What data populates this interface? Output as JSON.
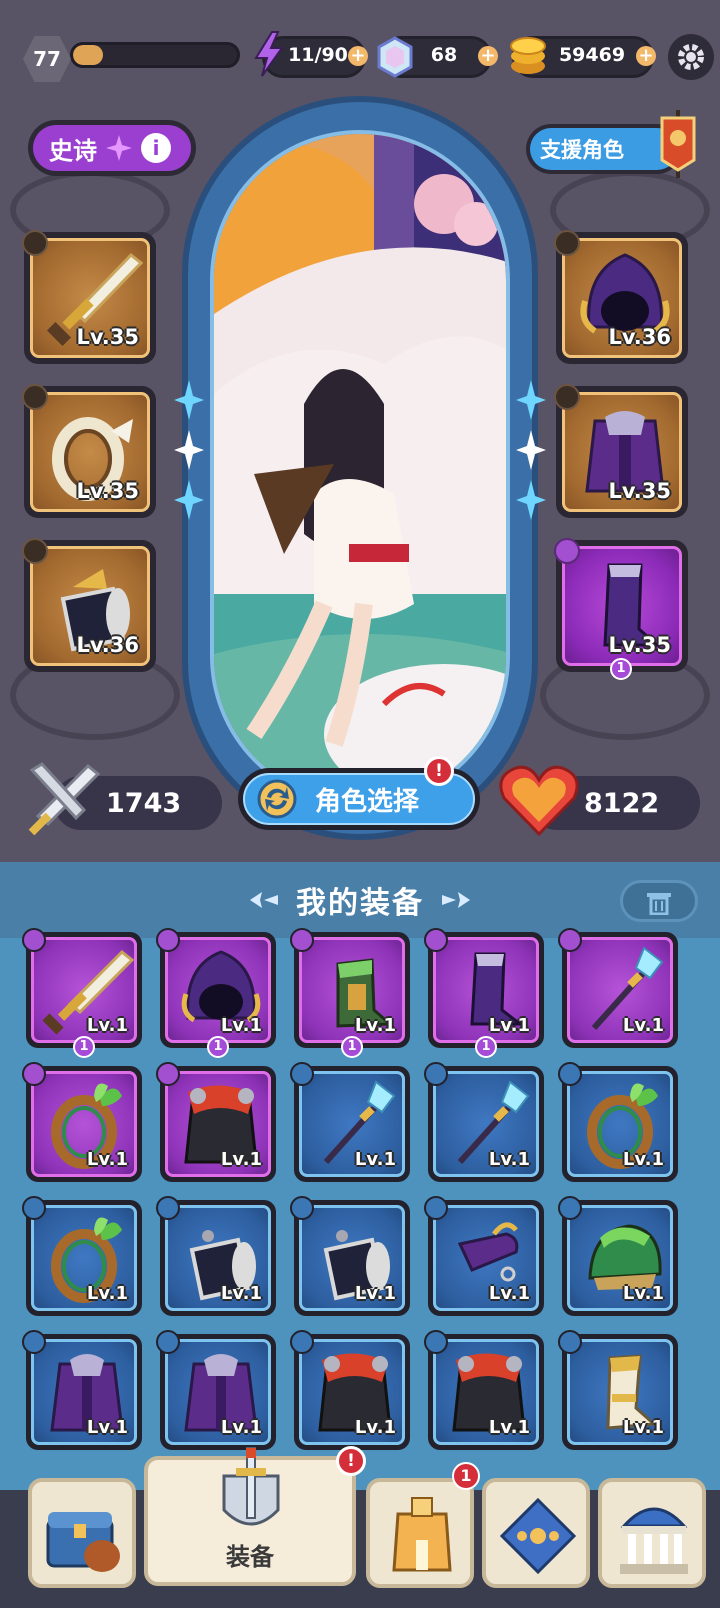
{
  "topbar": {
    "level": "77",
    "xp_progress": 0.18,
    "energy": "11/90",
    "gems": "68",
    "gold": "59469"
  },
  "hero": {
    "rarity": "史诗",
    "support_label": "支援角色",
    "power": "1743",
    "hp": "8122",
    "select_label": "角色选择",
    "select_alert": "!"
  },
  "equipped_left": [
    {
      "item": "sword",
      "level": "Lv.35"
    },
    {
      "item": "ring",
      "level": "Lv.35"
    },
    {
      "item": "bracer",
      "level": "Lv.36"
    }
  ],
  "equipped_right": [
    {
      "item": "hood",
      "level": "Lv.36",
      "rarity": "gold"
    },
    {
      "item": "armor",
      "level": "Lv.35",
      "rarity": "gold"
    },
    {
      "item": "boots",
      "level": "Lv.35",
      "rarity": "purple",
      "badge": "1"
    }
  ],
  "panel": {
    "title": "我的装备"
  },
  "inventory": [
    {
      "item": "sword",
      "level": "Lv.1",
      "rarity": "purple",
      "badge": "1"
    },
    {
      "item": "hood",
      "level": "Lv.1",
      "rarity": "purple",
      "badge": "1"
    },
    {
      "item": "boots-green",
      "level": "Lv.1",
      "rarity": "purple",
      "badge": "1"
    },
    {
      "item": "boots",
      "level": "Lv.1",
      "rarity": "purple",
      "badge": "1"
    },
    {
      "item": "spear",
      "level": "Lv.1",
      "rarity": "purple"
    },
    {
      "item": "ring-leaf",
      "level": "Lv.1",
      "rarity": "purple"
    },
    {
      "item": "armor-red",
      "level": "Lv.1",
      "rarity": "purple"
    },
    {
      "item": "spear",
      "level": "Lv.1",
      "rarity": "blue"
    },
    {
      "item": "spear",
      "level": "Lv.1",
      "rarity": "blue"
    },
    {
      "item": "ring-leaf",
      "level": "Lv.1",
      "rarity": "blue"
    },
    {
      "item": "ring-leaf",
      "level": "Lv.1",
      "rarity": "blue"
    },
    {
      "item": "bracer",
      "level": "Lv.1",
      "rarity": "blue"
    },
    {
      "item": "bracer",
      "level": "Lv.1",
      "rarity": "blue"
    },
    {
      "item": "wrap",
      "level": "Lv.1",
      "rarity": "blue"
    },
    {
      "item": "helm-green",
      "level": "Lv.1",
      "rarity": "blue"
    },
    {
      "item": "armor",
      "level": "Lv.1",
      "rarity": "blue"
    },
    {
      "item": "armor",
      "level": "Lv.1",
      "rarity": "blue"
    },
    {
      "item": "armor-red",
      "level": "Lv.1",
      "rarity": "blue"
    },
    {
      "item": "armor-red",
      "level": "Lv.1",
      "rarity": "blue"
    },
    {
      "item": "boots-gold",
      "level": "Lv.1",
      "rarity": "blue"
    }
  ],
  "nav": {
    "active_label": "装备",
    "equip_alert": "!",
    "hero_badge": "1"
  },
  "colors": {
    "epic": "#9a3fd0",
    "rare": "#2d5e9f",
    "gold": "#a36a30",
    "accent": "#3fa0ea"
  }
}
